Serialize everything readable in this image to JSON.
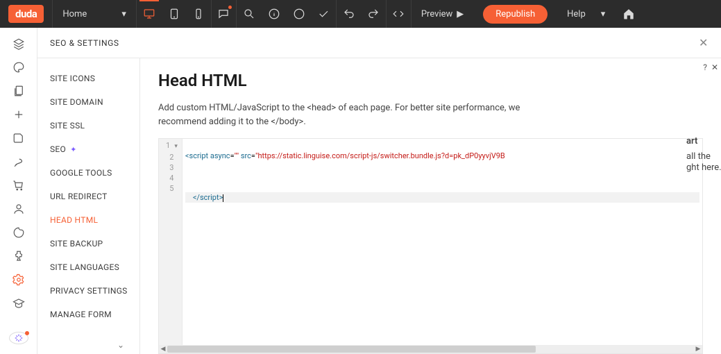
{
  "topbar": {
    "logo": "duda",
    "page_selector": "Home",
    "preview_label": "Preview",
    "republish_label": "Republish",
    "help_label": "Help"
  },
  "panel_title": "SEO & SETTINGS",
  "sidenav": [
    {
      "key": "site-icons",
      "label": "SITE ICONS"
    },
    {
      "key": "site-domain",
      "label": "SITE DOMAIN"
    },
    {
      "key": "site-ssl",
      "label": "SITE SSL"
    },
    {
      "key": "seo",
      "label": "SEO",
      "sparkle": true
    },
    {
      "key": "google-tools",
      "label": "GOOGLE TOOLS"
    },
    {
      "key": "url-redirect",
      "label": "URL REDIRECT"
    },
    {
      "key": "head-html",
      "label": "HEAD HTML",
      "active": true
    },
    {
      "key": "site-backup",
      "label": "SITE BACKUP"
    },
    {
      "key": "site-languages",
      "label": "SITE LANGUAGES"
    },
    {
      "key": "privacy-settings",
      "label": "PRIVACY SETTINGS"
    },
    {
      "key": "manage-form",
      "label": "MANAGE FORM"
    }
  ],
  "content": {
    "heading": "Head HTML",
    "description": "Add custom HTML/JavaScript to the <head> of each page. For better site performance, we recommend adding it to the </body>."
  },
  "code": {
    "line1": {
      "open": "<script",
      "attr_async": " async",
      "eq1": "=",
      "val_async": "\"\"",
      "attr_src": " src",
      "eq2": "=",
      "val_src": "\"https://static.linguise.com/script-js/switcher.bundle.js?d=pk_dP0yyvjV9B",
      "truncated": true
    },
    "line5": "    </script>",
    "line_numbers": [
      1,
      2,
      3,
      4,
      5
    ]
  },
  "rightpeek": {
    "l1": "art",
    "l2": "all the",
    "l3": "ght here."
  },
  "colors": {
    "accent": "#f66035"
  }
}
